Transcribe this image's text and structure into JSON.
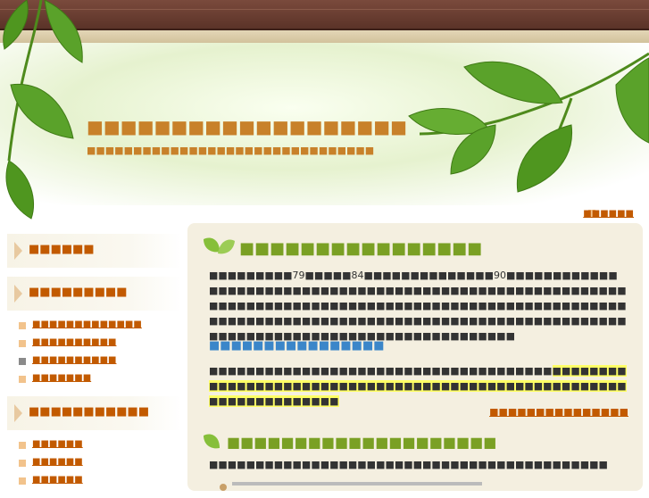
{
  "header": {
    "site_title": "■■■■■■■■■■■■■■■■■■■",
    "site_subtitle": "■■■■■■■■■■■■■■■■■■■■■■■■■■■■■■■",
    "top_link": "■■■■■■"
  },
  "sidebar": {
    "section1": {
      "title": "■■■■■■"
    },
    "section2": {
      "title": "■■■■■■■■■",
      "items": [
        {
          "label": "■■■■■■■■■■■■■"
        },
        {
          "label": "■■■■■■■■■■"
        },
        {
          "label": "■■■■■■■■■■"
        },
        {
          "label": "■■■■■■■"
        }
      ]
    },
    "section3": {
      "title": "■■■■■■■■■■■",
      "items": [
        {
          "label": "■■■■■■"
        },
        {
          "label": "■■■■■■"
        },
        {
          "label": "■■■■■■"
        }
      ]
    }
  },
  "main": {
    "article1": {
      "title": "■■■■■■■■■■■■■■■■",
      "paragraph": "■■■■■■■■■79■■■■■84■■■■■■■■■■■■■■90■■■■■■■■■■■■■■■■■■■■■■■■■■■■■■■■■■■■■■■■■■■■■■■■■■■■■■■■■■■■■■■■■■■■■■■■■■■■■■■■■■■■■■■■■■■■■■■■■■■■■■■■■■■■■■■■■■■■■■■■■■■■■■■■■■■■■■■■■■■■■■■■■■■■■■■■■■■■■■■■■■■■■■■■■■■■■■■■■■■■",
      "subheading": "■■■■■■■■■■■■■■■■",
      "paragraph2_plain": "■■■■■■■■■■■■■■■■■■■■■■■■■■■■■■■■■■■■■",
      "paragraph2_highlight": "■■■■■■■■■■■■■■■■■■■■■■■■■■■■■■■■■■■■■■■■■■■■■■■■■■■■■■■■■■■■■■■■■■■",
      "read_more": "■■■■■■■■■■■■■■■"
    },
    "article2": {
      "title": "■■■■■■■■■■■■■■■■■■■■",
      "paragraph": "■■■■■■■■■■■■■■■■■■■■■■■■■■■■■■■■■■■■■■■■■■■"
    }
  },
  "colors": {
    "accent_orange": "#c8812a",
    "link_orange": "#c25a00",
    "heading_green": "#7aa024",
    "subheading_blue": "#3b86c9",
    "highlight_yellow": "#ffff66"
  }
}
